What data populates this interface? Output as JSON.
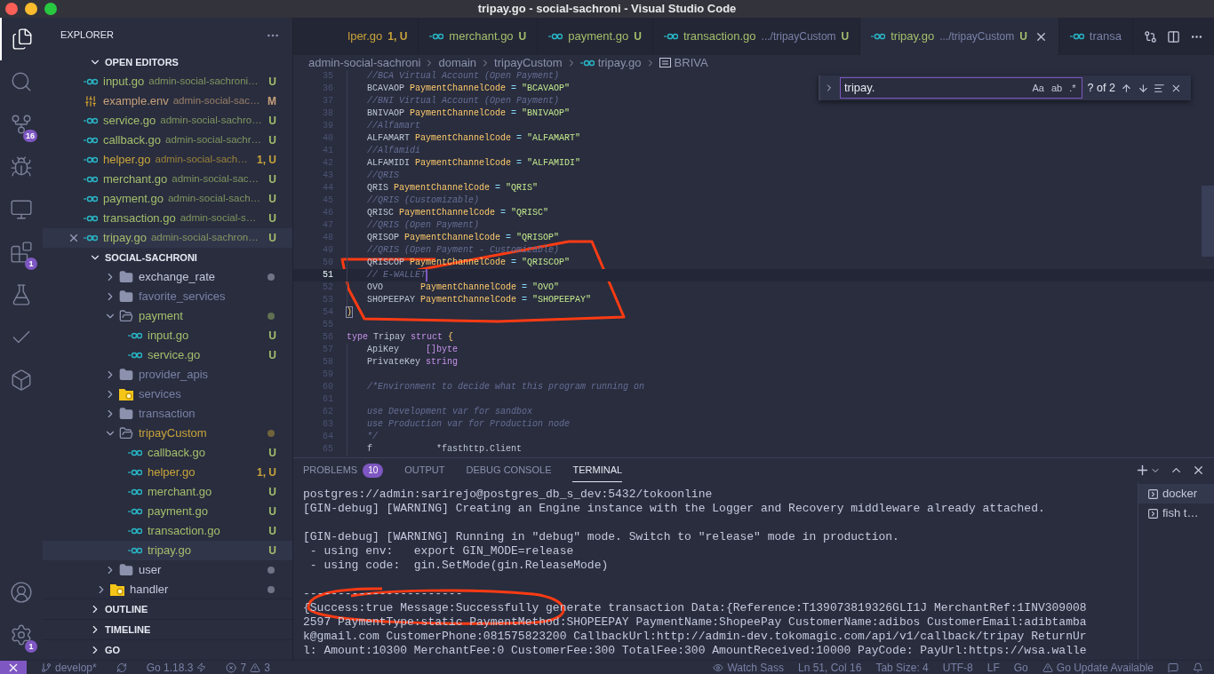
{
  "window": {
    "title": "tripay.go - social-sachroni - Visual Studio Code"
  },
  "activity_bar": {
    "items": [
      {
        "kind": "explorer",
        "selected": true
      },
      {
        "kind": "search",
        "selected": false
      },
      {
        "kind": "source-control",
        "selected": false,
        "badge": "16"
      },
      {
        "kind": "run",
        "selected": false
      },
      {
        "kind": "remote",
        "selected": false
      },
      {
        "kind": "extensions",
        "selected": false,
        "badge": "1"
      },
      {
        "kind": "testing",
        "selected": false
      },
      {
        "kind": "check",
        "selected": false
      },
      {
        "kind": "docker",
        "selected": false
      }
    ],
    "bottom": [
      {
        "kind": "account"
      },
      {
        "kind": "settings",
        "badge": "1"
      }
    ]
  },
  "sidebar": {
    "title": "EXPLORER",
    "open_editors": {
      "title": "OPEN EDITORS",
      "expanded": true,
      "items": [
        {
          "kind": "go",
          "name": "input.go",
          "path": "admin-social-sachroni…",
          "badge": "U",
          "color": "#a5bf6c",
          "selected": false
        },
        {
          "kind": "env",
          "name": "example.env",
          "path": "admin-social-sac…",
          "badge": "M",
          "color": "#c8a07a",
          "selected": false
        },
        {
          "kind": "go",
          "name": "service.go",
          "path": "admin-social-sachro…",
          "badge": "U",
          "color": "#a5bf6c",
          "selected": false
        },
        {
          "kind": "go",
          "name": "callback.go",
          "path": "admin-social-sachr…",
          "badge": "U",
          "color": "#a5bf6c",
          "selected": false
        },
        {
          "kind": "go",
          "name": "helper.go",
          "path": "admin-social-sach…",
          "badge": "1, U",
          "color": "#c9a43a",
          "selected": false
        },
        {
          "kind": "go",
          "name": "merchant.go",
          "path": "admin-social-sac…",
          "badge": "U",
          "color": "#a5bf6c",
          "selected": false
        },
        {
          "kind": "go",
          "name": "payment.go",
          "path": "admin-social-sach…",
          "badge": "U",
          "color": "#a5bf6c",
          "selected": false
        },
        {
          "kind": "go",
          "name": "transaction.go",
          "path": "admin-social-s…",
          "badge": "U",
          "color": "#a5bf6c",
          "selected": false
        },
        {
          "kind": "go",
          "name": "tripay.go",
          "path": "admin-social-sachron…",
          "badge": "U",
          "color": "#a5bf6c",
          "selected": true
        }
      ]
    },
    "workspace": {
      "title": "SOCIAL-SACHRONI",
      "expanded": true,
      "tree": [
        {
          "children": [
            {
              "kind": "folder",
              "name": "exchange_rate",
              "expanded": false,
              "color": "#c4c8dc",
              "dot": true
            },
            {
              "kind": "folder",
              "name": "favorite_services",
              "expanded": false,
              "color": "#7a81a6",
              "dot": false
            },
            {
              "kind": "folder",
              "name": "payment",
              "expanded": true,
              "color": "#a5bf6c",
              "dot": true,
              "children": [
                {
                  "kind": "go",
                  "name": "input.go",
                  "badge": "U",
                  "color": "#a5bf6c",
                  "selected": false
                },
                {
                  "kind": "go",
                  "name": "service.go",
                  "badge": "U",
                  "color": "#a5bf6c",
                  "selected": false
                }
              ]
            },
            {
              "kind": "folder",
              "name": "provider_apis",
              "expanded": false,
              "color": "#7a81a6",
              "dot": false
            },
            {
              "kind": "folder-special",
              "name": "services",
              "expanded": false,
              "color": "#7a81a6",
              "dot": false
            },
            {
              "kind": "folder",
              "name": "transaction",
              "expanded": false,
              "color": "#7a81a6",
              "dot": false
            },
            {
              "kind": "folder",
              "name": "tripayCustom",
              "expanded": true,
              "color": "#c9a43a",
              "dot": true,
              "children": [
                {
                  "kind": "go",
                  "name": "callback.go",
                  "badge": "U",
                  "color": "#a5bf6c",
                  "selected": false
                },
                {
                  "kind": "go",
                  "name": "helper.go",
                  "badge": "1, U",
                  "color": "#c9a43a",
                  "selected": false
                },
                {
                  "kind": "go",
                  "name": "merchant.go",
                  "badge": "U",
                  "color": "#a5bf6c",
                  "selected": false
                },
                {
                  "kind": "go",
                  "name": "payment.go",
                  "badge": "U",
                  "color": "#a5bf6c",
                  "selected": false
                },
                {
                  "kind": "go",
                  "name": "transaction.go",
                  "badge": "U",
                  "color": "#a5bf6c",
                  "selected": false
                },
                {
                  "kind": "go",
                  "name": "tripay.go",
                  "badge": "U",
                  "color": "#a5bf6c",
                  "selected": true
                }
              ]
            },
            {
              "kind": "folder",
              "name": "user",
              "expanded": false,
              "color": "#c4c8dc",
              "dot": true
            }
          ]
        },
        {
          "kind": "folder-special",
          "name": "handler",
          "expanded": false,
          "color": "#c4c8dc",
          "dot": true
        }
      ]
    },
    "sections": [
      {
        "title": "OUTLINE",
        "expanded": false
      },
      {
        "title": "TIMELINE",
        "expanded": false
      },
      {
        "title": "GO",
        "expanded": false
      }
    ]
  },
  "tabs": [
    {
      "kind": "cut",
      "name": "lper.go",
      "badge": "1, U",
      "color": "#c9a43a",
      "selected": false
    },
    {
      "kind": "go",
      "name": "merchant.go",
      "badge": "U",
      "color": "#a5bf6c",
      "selected": false
    },
    {
      "kind": "go",
      "name": "payment.go",
      "badge": "U",
      "color": "#a5bf6c",
      "selected": false
    },
    {
      "kind": "go",
      "name": "transaction.go",
      "detail": ".../tripayCustom",
      "badge": "U",
      "color": "#a5bf6c",
      "selected": false
    },
    {
      "kind": "go",
      "name": "tripay.go",
      "detail": ".../tripayCustom",
      "badge": "U",
      "color": "#a5bf6c",
      "selected": true
    },
    {
      "kind": "go",
      "name": "transa",
      "color": "#7a81a6",
      "selected": false
    }
  ],
  "breadcrumb": [
    {
      "kind": "text",
      "text": "admin-social-sachroni"
    },
    {
      "kind": "text",
      "text": "domain"
    },
    {
      "kind": "text",
      "text": "tripayCustom"
    },
    {
      "kind": "go",
      "text": "tripay.go"
    },
    {
      "kind": "symbol",
      "text": "BRIVA"
    }
  ],
  "find": {
    "value": "tripay.",
    "match_count": "? of 2",
    "replace_expanded": false,
    "toggles": [
      {
        "label": "Aa",
        "on": false
      },
      {
        "label": "ab",
        "on": false
      },
      {
        "label": ".*",
        "on": false
      }
    ]
  },
  "code": [
    {
      "num": "35",
      "indented": true,
      "current": false,
      "tokens": [
        {
          "kind": "comment",
          "text": "//BCA Virtual Account (Open Payment)"
        }
      ]
    },
    {
      "num": "36",
      "indented": true,
      "current": false,
      "tokens": [
        {
          "kind": "ident",
          "text": "BCAVAOP "
        },
        {
          "kind": "type",
          "text": "PaymentChannelCode"
        },
        {
          "kind": "op",
          "text": " = "
        },
        {
          "kind": "string",
          "text": "\"BCAVAOP\""
        }
      ]
    },
    {
      "num": "37",
      "indented": true,
      "current": false,
      "tokens": [
        {
          "kind": "comment",
          "text": "//BNI Virtual Account (Open Payment)"
        }
      ]
    },
    {
      "num": "38",
      "indented": true,
      "current": false,
      "tokens": [
        {
          "kind": "ident",
          "text": "BNIVAOP "
        },
        {
          "kind": "type",
          "text": "PaymentChannelCode"
        },
        {
          "kind": "op",
          "text": " = "
        },
        {
          "kind": "string",
          "text": "\"BNIVAOP\""
        }
      ]
    },
    {
      "num": "39",
      "indented": true,
      "current": false,
      "tokens": [
        {
          "kind": "comment",
          "text": "//Alfamart"
        }
      ]
    },
    {
      "num": "40",
      "indented": true,
      "current": false,
      "tokens": [
        {
          "kind": "ident",
          "text": "ALFAMART "
        },
        {
          "kind": "type",
          "text": "PaymentChannelCode"
        },
        {
          "kind": "op",
          "text": " = "
        },
        {
          "kind": "string",
          "text": "\"ALFAMART\""
        }
      ]
    },
    {
      "num": "41",
      "indented": true,
      "current": false,
      "tokens": [
        {
          "kind": "comment",
          "text": "//Alfamidi"
        }
      ]
    },
    {
      "num": "42",
      "indented": true,
      "current": false,
      "tokens": [
        {
          "kind": "ident",
          "text": "ALFAMIDI "
        },
        {
          "kind": "type",
          "text": "PaymentChannelCode"
        },
        {
          "kind": "op",
          "text": " = "
        },
        {
          "kind": "string",
          "text": "\"ALFAMIDI\""
        }
      ]
    },
    {
      "num": "43",
      "indented": true,
      "current": false,
      "tokens": [
        {
          "kind": "comment",
          "text": "//QRIS"
        }
      ]
    },
    {
      "num": "44",
      "indented": true,
      "current": false,
      "tokens": [
        {
          "kind": "ident",
          "text": "QRIS "
        },
        {
          "kind": "type",
          "text": "PaymentChannelCode"
        },
        {
          "kind": "op",
          "text": " = "
        },
        {
          "kind": "string",
          "text": "\"QRIS\""
        }
      ]
    },
    {
      "num": "45",
      "indented": true,
      "current": false,
      "tokens": [
        {
          "kind": "comment",
          "text": "//QRIS (Customizable)"
        }
      ]
    },
    {
      "num": "46",
      "indented": true,
      "current": false,
      "tokens": [
        {
          "kind": "ident",
          "text": "QRISC "
        },
        {
          "kind": "type",
          "text": "PaymentChannelCode"
        },
        {
          "kind": "op",
          "text": " = "
        },
        {
          "kind": "string",
          "text": "\"QRISC\""
        }
      ]
    },
    {
      "num": "47",
      "indented": true,
      "current": false,
      "tokens": [
        {
          "kind": "comment",
          "text": "//QRIS (Open Payment)"
        }
      ]
    },
    {
      "num": "48",
      "indented": true,
      "current": false,
      "tokens": [
        {
          "kind": "ident",
          "text": "QRISOP "
        },
        {
          "kind": "type",
          "text": "PaymentChannelCode"
        },
        {
          "kind": "op",
          "text": " = "
        },
        {
          "kind": "string",
          "text": "\"QRISOP\""
        }
      ]
    },
    {
      "num": "49",
      "indented": true,
      "current": false,
      "tokens": [
        {
          "kind": "comment",
          "text": "//QRIS (Open Payment - Customizable)"
        }
      ]
    },
    {
      "num": "50",
      "indented": true,
      "current": false,
      "tokens": [
        {
          "kind": "ident",
          "text": "QRISCOP "
        },
        {
          "kind": "type",
          "text": "PaymentChannelCode"
        },
        {
          "kind": "op",
          "text": " = "
        },
        {
          "kind": "string",
          "text": "\"QRISCOP\""
        }
      ]
    },
    {
      "num": "51",
      "indented": true,
      "current": true,
      "tokens": [
        {
          "kind": "comment",
          "text": "// E-WALLET"
        }
      ]
    },
    {
      "num": "52",
      "indented": true,
      "current": false,
      "tokens": [
        {
          "kind": "ident",
          "text": "OVO       "
        },
        {
          "kind": "type",
          "text": "PaymentChannelCode"
        },
        {
          "kind": "op",
          "text": " = "
        },
        {
          "kind": "string",
          "text": "\"OVO\""
        }
      ]
    },
    {
      "num": "53",
      "indented": true,
      "current": false,
      "tokens": [
        {
          "kind": "ident",
          "text": "SHOPEEPAY "
        },
        {
          "kind": "type",
          "text": "PaymentChannelCode"
        },
        {
          "kind": "op",
          "text": " = "
        },
        {
          "kind": "string",
          "text": "\"SHOPEEPAY\""
        }
      ]
    },
    {
      "num": "54",
      "indented": false,
      "current": false,
      "tokens": [
        {
          "kind": "bracket-match",
          "text": ")"
        }
      ]
    },
    {
      "num": "55",
      "indented": false,
      "current": false
    },
    {
      "num": "56",
      "indented": false,
      "current": false,
      "tokens": [
        {
          "kind": "keyword",
          "text": "type "
        },
        {
          "kind": "ident",
          "text": "Tripay "
        },
        {
          "kind": "keyword",
          "text": "struct "
        },
        {
          "kind": "brace",
          "text": "{"
        }
      ]
    },
    {
      "num": "57",
      "indented": true,
      "current": false,
      "tokens": [
        {
          "kind": "ident",
          "text": "ApiKey     "
        },
        {
          "kind": "keyword",
          "text": "[]byte"
        }
      ]
    },
    {
      "num": "58",
      "indented": true,
      "current": false,
      "tokens": [
        {
          "kind": "ident",
          "text": "PrivateKey "
        },
        {
          "kind": "keyword",
          "text": "string"
        }
      ]
    },
    {
      "num": "59",
      "indented": true,
      "current": false
    },
    {
      "num": "60",
      "indented": true,
      "current": false,
      "tokens": [
        {
          "kind": "comment",
          "text": "/*Environment to decide what this program running on"
        }
      ]
    },
    {
      "num": "61",
      "indented": true,
      "current": false
    },
    {
      "num": "62",
      "indented": true,
      "current": false,
      "tokens": [
        {
          "kind": "comment",
          "text": "use Development var for sandbox"
        }
      ]
    },
    {
      "num": "63",
      "indented": true,
      "current": false,
      "tokens": [
        {
          "kind": "comment",
          "text": "use Production var for Production node"
        }
      ]
    },
    {
      "num": "64",
      "indented": true,
      "current": false,
      "tokens": [
        {
          "kind": "comment",
          "text": "*/"
        }
      ]
    },
    {
      "num": "65",
      "indented": true,
      "current": false,
      "tokens": [
        {
          "kind": "ident",
          "text": "f            *fasthttp.Client"
        }
      ]
    }
  ],
  "panel": {
    "tabs": [
      {
        "label": "PROBLEMS",
        "badge": "10",
        "selected": false
      },
      {
        "label": "OUTPUT",
        "selected": false
      },
      {
        "label": "DEBUG CONSOLE",
        "selected": false
      },
      {
        "label": "TERMINAL",
        "selected": true
      }
    ],
    "terminals": [
      {
        "name": "docker",
        "selected": true
      },
      {
        "name": "fish t…",
        "selected": false
      }
    ],
    "output": [
      [
        "postgres://admin:sarirejo@postgres_db_s_dev:5432/tokoonline",
        "[GIN-debug] [WARNING] Creating an Engine instance with the Logger and Recovery middleware already attached."
      ],
      [
        "[GIN-debug] [WARNING] Running in \"debug\" mode. Switch to \"release\" mode in production.",
        " - using env:   export GIN_MODE=release",
        " - using code:  gin.SetMode(gin.ReleaseMode)"
      ],
      [
        "-----------------------",
        "{Success:true Message:Successfully generate transaction Data:{Reference:T139073819326GLI1J MerchantRef:1INV309008",
        "2597 PaymentType:static PaymentMethod:SHOPEEPAY PaymentName:ShopeePay CustomerName:adibos CustomerEmail:adibtamba",
        "k@gmail.com CustomerPhone:081575823200 CallbackUrl:http://admin-dev.tokomagic.com/api/v1/callback/tripay ReturnUr",
        "l: Amount:10300 MerchantFee:0 CustomerFee:300 TotalFee:300 AmountReceived:10000 PayCode: PayUrl:https://wsa.walle"
      ]
    ]
  },
  "status_bar": {
    "left": [
      {
        "kind": "remote"
      },
      {
        "kind": "branch",
        "text": "develop*"
      },
      {
        "kind": "sync"
      },
      {
        "kind": "go-version",
        "text": "Go 1.18.3"
      },
      {
        "kind": "problems",
        "errors": "7",
        "warnings": "3"
      }
    ],
    "right": [
      {
        "kind": "watch",
        "text": "Watch Sass"
      },
      {
        "kind": "text",
        "text": "Ln 51, Col 16"
      },
      {
        "kind": "text",
        "text": "Tab Size: 4"
      },
      {
        "kind": "text",
        "text": "UTF-8"
      },
      {
        "kind": "text",
        "text": "LF"
      },
      {
        "kind": "text",
        "text": "Go"
      },
      {
        "kind": "warning",
        "text": "Go Update Available"
      },
      {
        "kind": "feedback"
      },
      {
        "kind": "bell"
      }
    ]
  }
}
